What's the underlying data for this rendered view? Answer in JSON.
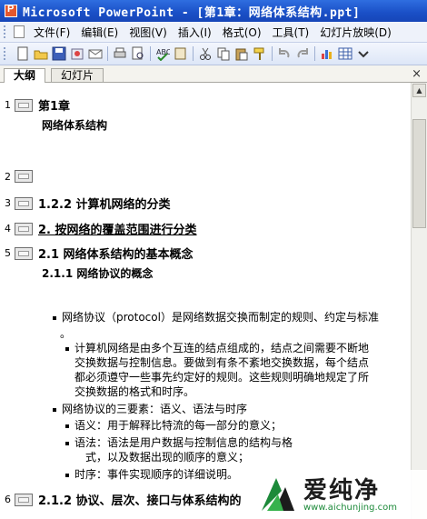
{
  "window": {
    "title": "Microsoft PowerPoint - [第1章：网络体系结构.ppt]"
  },
  "menu": {
    "items": [
      "文件(F)",
      "编辑(E)",
      "视图(V)",
      "插入(I)",
      "格式(O)",
      "工具(T)",
      "幻灯片放映(D)"
    ]
  },
  "toolbar": {
    "buttons": [
      "new-icon",
      "open-icon",
      "save-icon",
      "permission-icon",
      "email-icon",
      "print-icon",
      "print-preview-icon",
      "spelling-icon",
      "research-icon",
      "cut-icon",
      "copy-icon",
      "paste-icon",
      "format-painter-icon",
      "undo-icon",
      "redo-icon",
      "chart-icon",
      "table-icon",
      "expand-icon"
    ]
  },
  "tabs": {
    "outline": "大纲",
    "slides": "幻灯片",
    "close": "×"
  },
  "outline": {
    "slides": [
      {
        "num": "1",
        "title": "第1章",
        "sub": "网络体系结构"
      },
      {
        "num": "2",
        "title": ""
      },
      {
        "num": "3",
        "title": "1.2.2 计算机网络的分类"
      },
      {
        "num": "4",
        "title": "2. 按网络的覆盖范围进行分类"
      },
      {
        "num": "5",
        "title": "2.1  网络体系结构的基本概念",
        "sub": "2.1.1  网络协议的概念"
      },
      {
        "num": "6",
        "title": "2.1.2  协议、层次、接口与体系结构的"
      }
    ],
    "bullets": [
      "网络协议（protocol）是网络数据交换而制定的规则、约定与标准",
      "。",
      "计算机网络是由多个互连的结点组成的，结点之间需要不断地",
      "交换数据与控制信息。要做到有条不紊地交换数据，每个结点",
      "都必须遵守一些事先约定好的规则。这些规则明确地规定了所",
      "交换数据的格式和时序。",
      "网络协议的三要素：语义、语法与时序",
      "语义：用于解释比特流的每一部分的意义；",
      "语法：语法是用户数据与控制信息的结构与格",
      "式，以及数据出现的顺序的意义；",
      "时序：事件实现顺序的详细说明。"
    ]
  },
  "watermark": {
    "text": "爱纯净",
    "url": "www.aichunjing.com"
  },
  "colors": {
    "titlebar": "#1a4fc6",
    "watermark_green": "#1d8a3a"
  }
}
